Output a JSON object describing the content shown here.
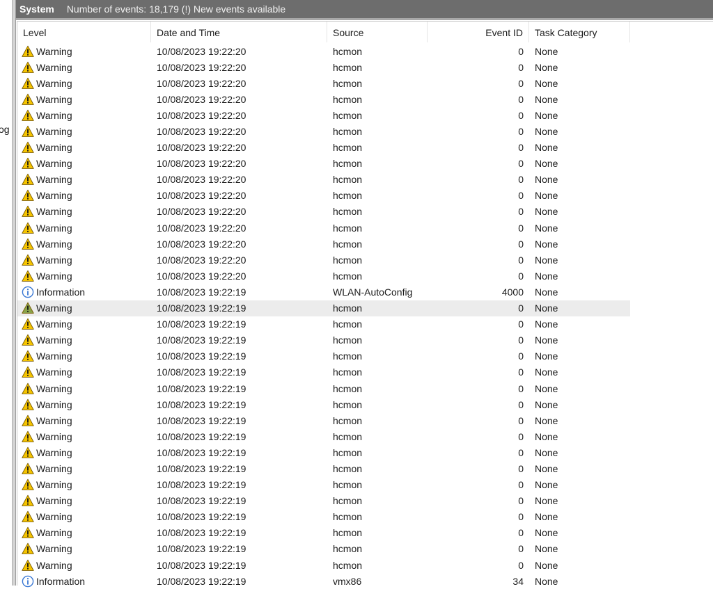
{
  "left_pane": {
    "clipped_text": "og"
  },
  "title_bar": {
    "log_name": "System",
    "status": "Number of events: 18,179 (!) New events available"
  },
  "columns": {
    "level": "Level",
    "date_time": "Date and Time",
    "source": "Source",
    "event_id": "Event ID",
    "task_category": "Task Category"
  },
  "colors": {
    "warning": "#f5c400",
    "information": "#3a78d4",
    "selected_row": "#ececec",
    "title_bar": "#6d6d6d"
  },
  "selected_row_index": 16,
  "events": [
    {
      "level": "Warning",
      "icon": "warning-icon",
      "date_time": "10/08/2023 19:22:20",
      "source": "hcmon",
      "event_id": "0",
      "task_category": "None"
    },
    {
      "level": "Warning",
      "icon": "warning-icon",
      "date_time": "10/08/2023 19:22:20",
      "source": "hcmon",
      "event_id": "0",
      "task_category": "None"
    },
    {
      "level": "Warning",
      "icon": "warning-icon",
      "date_time": "10/08/2023 19:22:20",
      "source": "hcmon",
      "event_id": "0",
      "task_category": "None"
    },
    {
      "level": "Warning",
      "icon": "warning-icon",
      "date_time": "10/08/2023 19:22:20",
      "source": "hcmon",
      "event_id": "0",
      "task_category": "None"
    },
    {
      "level": "Warning",
      "icon": "warning-icon",
      "date_time": "10/08/2023 19:22:20",
      "source": "hcmon",
      "event_id": "0",
      "task_category": "None"
    },
    {
      "level": "Warning",
      "icon": "warning-icon",
      "date_time": "10/08/2023 19:22:20",
      "source": "hcmon",
      "event_id": "0",
      "task_category": "None"
    },
    {
      "level": "Warning",
      "icon": "warning-icon",
      "date_time": "10/08/2023 19:22:20",
      "source": "hcmon",
      "event_id": "0",
      "task_category": "None"
    },
    {
      "level": "Warning",
      "icon": "warning-icon",
      "date_time": "10/08/2023 19:22:20",
      "source": "hcmon",
      "event_id": "0",
      "task_category": "None"
    },
    {
      "level": "Warning",
      "icon": "warning-icon",
      "date_time": "10/08/2023 19:22:20",
      "source": "hcmon",
      "event_id": "0",
      "task_category": "None"
    },
    {
      "level": "Warning",
      "icon": "warning-icon",
      "date_time": "10/08/2023 19:22:20",
      "source": "hcmon",
      "event_id": "0",
      "task_category": "None"
    },
    {
      "level": "Warning",
      "icon": "warning-icon",
      "date_time": "10/08/2023 19:22:20",
      "source": "hcmon",
      "event_id": "0",
      "task_category": "None"
    },
    {
      "level": "Warning",
      "icon": "warning-icon",
      "date_time": "10/08/2023 19:22:20",
      "source": "hcmon",
      "event_id": "0",
      "task_category": "None"
    },
    {
      "level": "Warning",
      "icon": "warning-icon",
      "date_time": "10/08/2023 19:22:20",
      "source": "hcmon",
      "event_id": "0",
      "task_category": "None"
    },
    {
      "level": "Warning",
      "icon": "warning-icon",
      "date_time": "10/08/2023 19:22:20",
      "source": "hcmon",
      "event_id": "0",
      "task_category": "None"
    },
    {
      "level": "Warning",
      "icon": "warning-icon",
      "date_time": "10/08/2023 19:22:20",
      "source": "hcmon",
      "event_id": "0",
      "task_category": "None"
    },
    {
      "level": "Information",
      "icon": "information-icon",
      "date_time": "10/08/2023 19:22:19",
      "source": "WLAN-AutoConfig",
      "event_id": "4000",
      "task_category": "None"
    },
    {
      "level": "Warning",
      "icon": "warning-icon",
      "date_time": "10/08/2023 19:22:19",
      "source": "hcmon",
      "event_id": "0",
      "task_category": "None"
    },
    {
      "level": "Warning",
      "icon": "warning-icon",
      "date_time": "10/08/2023 19:22:19",
      "source": "hcmon",
      "event_id": "0",
      "task_category": "None"
    },
    {
      "level": "Warning",
      "icon": "warning-icon",
      "date_time": "10/08/2023 19:22:19",
      "source": "hcmon",
      "event_id": "0",
      "task_category": "None"
    },
    {
      "level": "Warning",
      "icon": "warning-icon",
      "date_time": "10/08/2023 19:22:19",
      "source": "hcmon",
      "event_id": "0",
      "task_category": "None"
    },
    {
      "level": "Warning",
      "icon": "warning-icon",
      "date_time": "10/08/2023 19:22:19",
      "source": "hcmon",
      "event_id": "0",
      "task_category": "None"
    },
    {
      "level": "Warning",
      "icon": "warning-icon",
      "date_time": "10/08/2023 19:22:19",
      "source": "hcmon",
      "event_id": "0",
      "task_category": "None"
    },
    {
      "level": "Warning",
      "icon": "warning-icon",
      "date_time": "10/08/2023 19:22:19",
      "source": "hcmon",
      "event_id": "0",
      "task_category": "None"
    },
    {
      "level": "Warning",
      "icon": "warning-icon",
      "date_time": "10/08/2023 19:22:19",
      "source": "hcmon",
      "event_id": "0",
      "task_category": "None"
    },
    {
      "level": "Warning",
      "icon": "warning-icon",
      "date_time": "10/08/2023 19:22:19",
      "source": "hcmon",
      "event_id": "0",
      "task_category": "None"
    },
    {
      "level": "Warning",
      "icon": "warning-icon",
      "date_time": "10/08/2023 19:22:19",
      "source": "hcmon",
      "event_id": "0",
      "task_category": "None"
    },
    {
      "level": "Warning",
      "icon": "warning-icon",
      "date_time": "10/08/2023 19:22:19",
      "source": "hcmon",
      "event_id": "0",
      "task_category": "None"
    },
    {
      "level": "Warning",
      "icon": "warning-icon",
      "date_time": "10/08/2023 19:22:19",
      "source": "hcmon",
      "event_id": "0",
      "task_category": "None"
    },
    {
      "level": "Warning",
      "icon": "warning-icon",
      "date_time": "10/08/2023 19:22:19",
      "source": "hcmon",
      "event_id": "0",
      "task_category": "None"
    },
    {
      "level": "Warning",
      "icon": "warning-icon",
      "date_time": "10/08/2023 19:22:19",
      "source": "hcmon",
      "event_id": "0",
      "task_category": "None"
    },
    {
      "level": "Warning",
      "icon": "warning-icon",
      "date_time": "10/08/2023 19:22:19",
      "source": "hcmon",
      "event_id": "0",
      "task_category": "None"
    },
    {
      "level": "Warning",
      "icon": "warning-icon",
      "date_time": "10/08/2023 19:22:19",
      "source": "hcmon",
      "event_id": "0",
      "task_category": "None"
    },
    {
      "level": "Warning",
      "icon": "warning-icon",
      "date_time": "10/08/2023 19:22:19",
      "source": "hcmon",
      "event_id": "0",
      "task_category": "None"
    },
    {
      "level": "Information",
      "icon": "information-icon",
      "date_time": "10/08/2023 19:22:19",
      "source": "vmx86",
      "event_id": "34",
      "task_category": "None"
    }
  ]
}
